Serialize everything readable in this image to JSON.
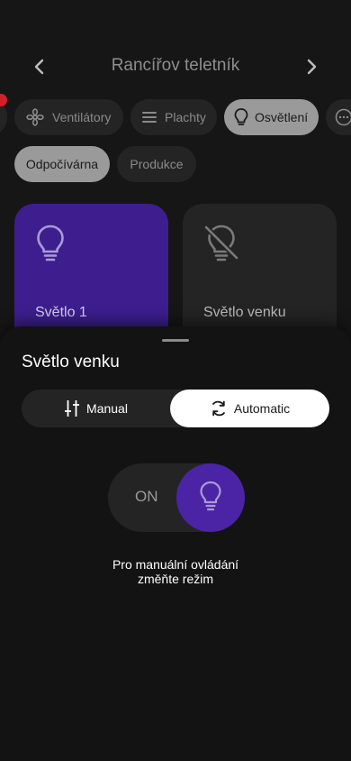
{
  "header": {
    "title": "Rancířov teletník",
    "prev_icon": "chevron-left-icon",
    "next_icon": "chevron-right-icon"
  },
  "categories": [
    {
      "label": "Ventilátory",
      "icon": "fan-icon",
      "selected": false
    },
    {
      "label": "Plachty",
      "icon": "menu-lines-icon",
      "selected": false
    },
    {
      "label": "Osvětlení",
      "icon": "lightbulb-icon",
      "selected": true
    },
    {
      "label": "",
      "icon": "more-icon",
      "selected": false
    }
  ],
  "rooms": [
    {
      "label": "Odpočívárna",
      "selected": true
    },
    {
      "label": "Produkce",
      "selected": false
    }
  ],
  "devices": [
    {
      "name": "Světlo 1",
      "icon": "lightbulb-icon",
      "on": true
    },
    {
      "name": "Světlo venku",
      "icon": "lightbulb-off-icon",
      "on": false
    }
  ],
  "sheet": {
    "title": "Světlo venku",
    "mode_manual": "Manual",
    "mode_automatic": "Automatic",
    "selected_mode": "Automatic",
    "toggle_label": "ON",
    "hint_line1": "Pro manuální ovládání",
    "hint_line2": "změňte režim"
  },
  "colors": {
    "background": "#161616",
    "accent": "#3e1e8e",
    "toggle_on": "#4a24a4",
    "badge": "#d21f2a"
  }
}
